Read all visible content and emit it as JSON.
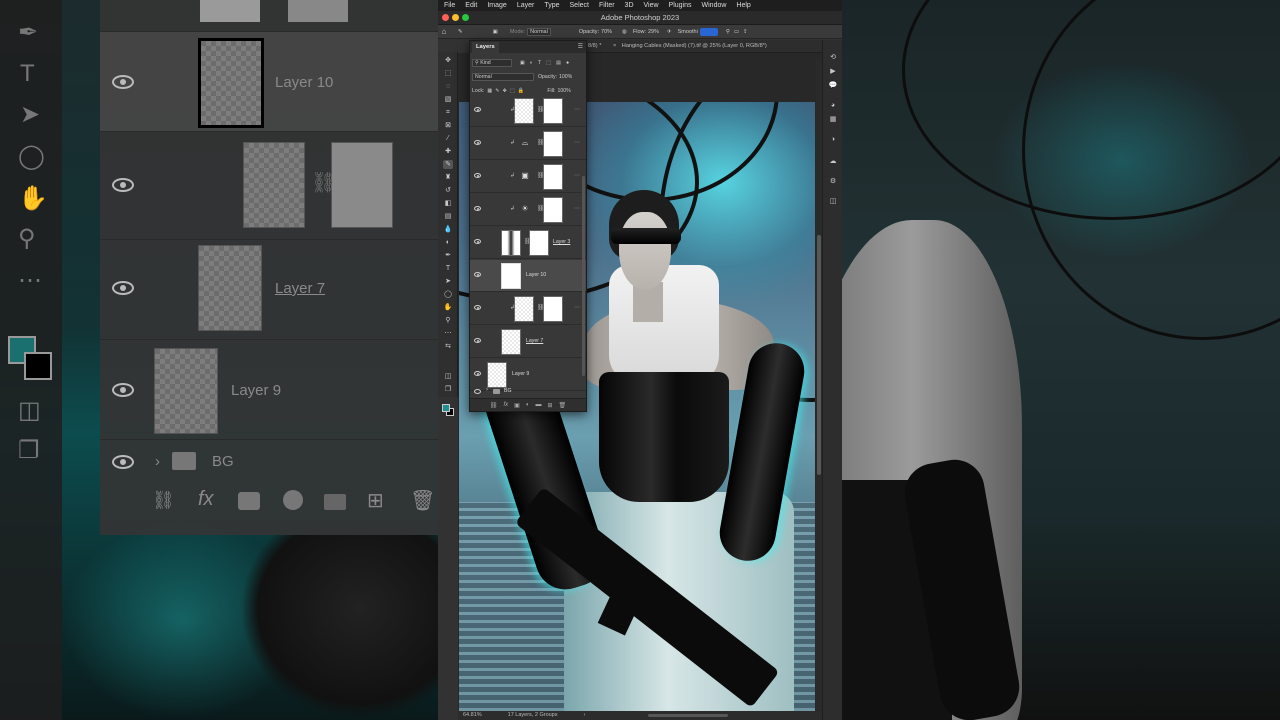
{
  "menubar": {
    "items": [
      "File",
      "Edit",
      "Image",
      "Layer",
      "Type",
      "Select",
      "Filter",
      "3D",
      "View",
      "Plugins",
      "Window",
      "Help"
    ]
  },
  "window": {
    "title": "Adobe Photoshop 2023",
    "traffic_lights": [
      "#fe5f57",
      "#febc2e",
      "#28c840"
    ]
  },
  "options_bar": {
    "mode_label": "Mode:",
    "mode_value": "Normal",
    "opacity_label": "Opacity:",
    "opacity_value": "70%",
    "flow_label": "Flow:",
    "flow_value": "29%",
    "smoothing_label": "Smoothi"
  },
  "document_tab": {
    "fragment": "8/8) *",
    "title": "Hanging Cables (Masked) (7).tif @ 25% (Layer 0, RGB/8*)"
  },
  "layers_panel": {
    "tab_label": "Layers",
    "filter_label": "Kind",
    "blend_mode": "Normal",
    "opacity_label": "Opacity:",
    "opacity_value": "100%",
    "lock_label": "Lock:",
    "fill_label": "Fill:",
    "fill_value": "100%",
    "layers": [
      {
        "name": "",
        "type": "pixel-mask",
        "clipped": true
      },
      {
        "name": "",
        "type": "adjustment",
        "icon": "curves-icon",
        "clipped": true
      },
      {
        "name": "",
        "type": "adjustment",
        "icon": "photo-filter-icon",
        "clipped": true
      },
      {
        "name": "",
        "type": "adjustment",
        "icon": "brightness-icon",
        "clipped": true
      },
      {
        "name": "Layer 3",
        "type": "pixel-mask",
        "clipped": false
      },
      {
        "name": "Layer 10",
        "type": "pixel",
        "clipped": false,
        "selected": true
      },
      {
        "name": "",
        "type": "pixel-mask",
        "clipped": true
      },
      {
        "name": "Layer 7",
        "type": "pixel",
        "clipped": false
      },
      {
        "name": "Layer 9",
        "type": "pixel",
        "clipped": false
      }
    ],
    "group": {
      "name": "BG"
    }
  },
  "status_bar": {
    "zoom": "64.81%",
    "doc_info": "17 Layers, 2 Groups"
  },
  "background_blur": {
    "labels": [
      "Layer 10",
      "Layer 7",
      "Layer 9",
      "BG"
    ]
  },
  "colors": {
    "foreground_swatch": "#1f8f8f",
    "background_swatch": "#000000",
    "accent": "#2a66d1"
  }
}
